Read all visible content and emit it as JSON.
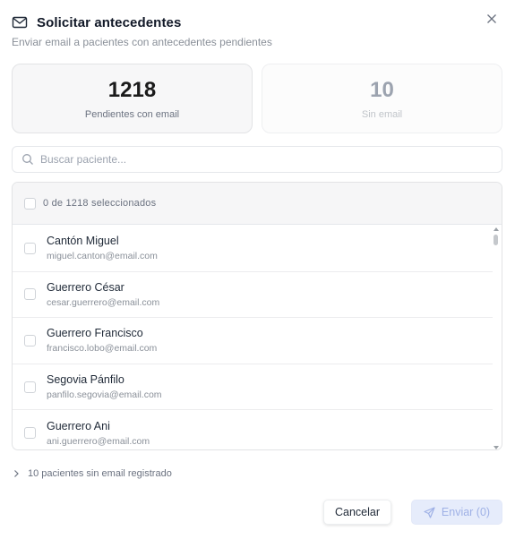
{
  "dialog": {
    "title": "Solicitar antecedentes",
    "subtitle": "Enviar email a pacientes con antecedentes pendientes"
  },
  "stats": {
    "pending": {
      "value": "1218",
      "label": "Pendientes con email"
    },
    "no_email": {
      "value": "10",
      "label": "Sin email"
    }
  },
  "search": {
    "placeholder": "Buscar paciente...",
    "value": ""
  },
  "list": {
    "selection_label": "0 de 1218 seleccionados",
    "rows": [
      {
        "name": "Cantón Miguel",
        "email": "miguel.canton@email.com"
      },
      {
        "name": "Guerrero César",
        "email": "cesar.guerrero@email.com"
      },
      {
        "name": "Guerrero Francisco",
        "email": "francisco.lobo@email.com"
      },
      {
        "name": "Segovia Pánfilo",
        "email": "panfilo.segovia@email.com"
      },
      {
        "name": "Guerrero Ani",
        "email": "ani.guerrero@email.com"
      }
    ]
  },
  "no_email_section": {
    "label": "10 pacientes sin email registrado"
  },
  "actions": {
    "cancel_label": "Cancelar",
    "send_label": "Enviar (0)"
  },
  "icons": {
    "header": "mail-icon",
    "close": "close-icon",
    "search": "search-icon",
    "collapsible": "chevron-right-icon",
    "send": "send-icon"
  },
  "colors": {
    "send_button_bg": "#e6ecfb",
    "send_button_text": "#9fb1e6",
    "pending_card_bg": "#f7f7f8"
  }
}
